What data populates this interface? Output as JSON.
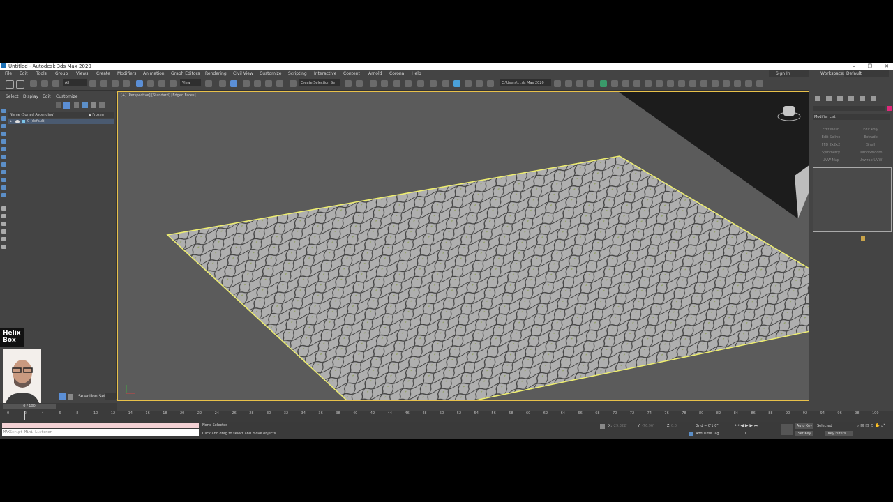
{
  "window": {
    "title": "Untitled - Autodesk 3ds Max 2020",
    "controls": [
      "–",
      "❐",
      "✕"
    ]
  },
  "menu": [
    "File",
    "Edit",
    "Tools",
    "Group",
    "Views",
    "Create",
    "Modifiers",
    "Animation",
    "Graph Editors",
    "Rendering",
    "Civil View",
    "Customize",
    "Scripting",
    "Interactive",
    "Content",
    "Arnold",
    "Corona",
    "Help"
  ],
  "account": {
    "sign_in": "Sign In",
    "workspaces_label": "Workspaces:",
    "workspace": "Default"
  },
  "toolbar": {
    "filter": "All",
    "view": "View",
    "selection_set": "Create Selection Se",
    "path": "C:\\Users\\j...ds Max 2020"
  },
  "scene_explorer": {
    "tabs": [
      "Select",
      "Display",
      "Edit",
      "Customize"
    ],
    "col_name": "Name (Sorted Ascending)",
    "col_frozen": "▲ Frozen",
    "layer": "0 (default)",
    "selection_set": "Selection Set:"
  },
  "viewport": {
    "label": "[+] [Perspective] [Standard] [Edged Faces]"
  },
  "command_panel": {
    "modifier_list": "Modifier List",
    "buttons": [
      "Edit Mesh",
      "Edit Poly",
      "Edit Spline",
      "Extrude",
      "FFD 2x2x2",
      "Shell",
      "Symmetry",
      "TurboSmooth",
      "UVW Map",
      "Unwrap UVW"
    ]
  },
  "timeline": {
    "frame_counter": "0 / 100",
    "ticks": [
      "0",
      "2",
      "4",
      "6",
      "8",
      "10",
      "12",
      "14",
      "16",
      "18",
      "20",
      "22",
      "24",
      "26",
      "28",
      "30",
      "32",
      "34",
      "36",
      "38",
      "40",
      "42",
      "44",
      "46",
      "48",
      "50",
      "52",
      "54",
      "56",
      "58",
      "60",
      "62",
      "64",
      "66",
      "68",
      "70",
      "72",
      "74",
      "76",
      "78",
      "80",
      "82",
      "84",
      "86",
      "88",
      "90",
      "92",
      "94",
      "96",
      "98",
      "100"
    ]
  },
  "status": {
    "maxscript": "MAXScript Mini Listener",
    "selection": "None Selected",
    "prompt": "Click and drag to select and move objects",
    "x": "X:",
    "x_val": "-29.322'",
    "y": "Y:",
    "y_val": "-76.96'",
    "z": "Z:",
    "z_val": "0.0'",
    "grid": "Grid = 0'1.0\"",
    "add_time_tag": "Add Time Tag",
    "auto_key": "Auto Key",
    "selected": "Selected",
    "set_key": "Set Key",
    "key_filters": "Key Filters...",
    "frame": "0"
  },
  "webcam": {
    "logo": "Helix Box"
  }
}
